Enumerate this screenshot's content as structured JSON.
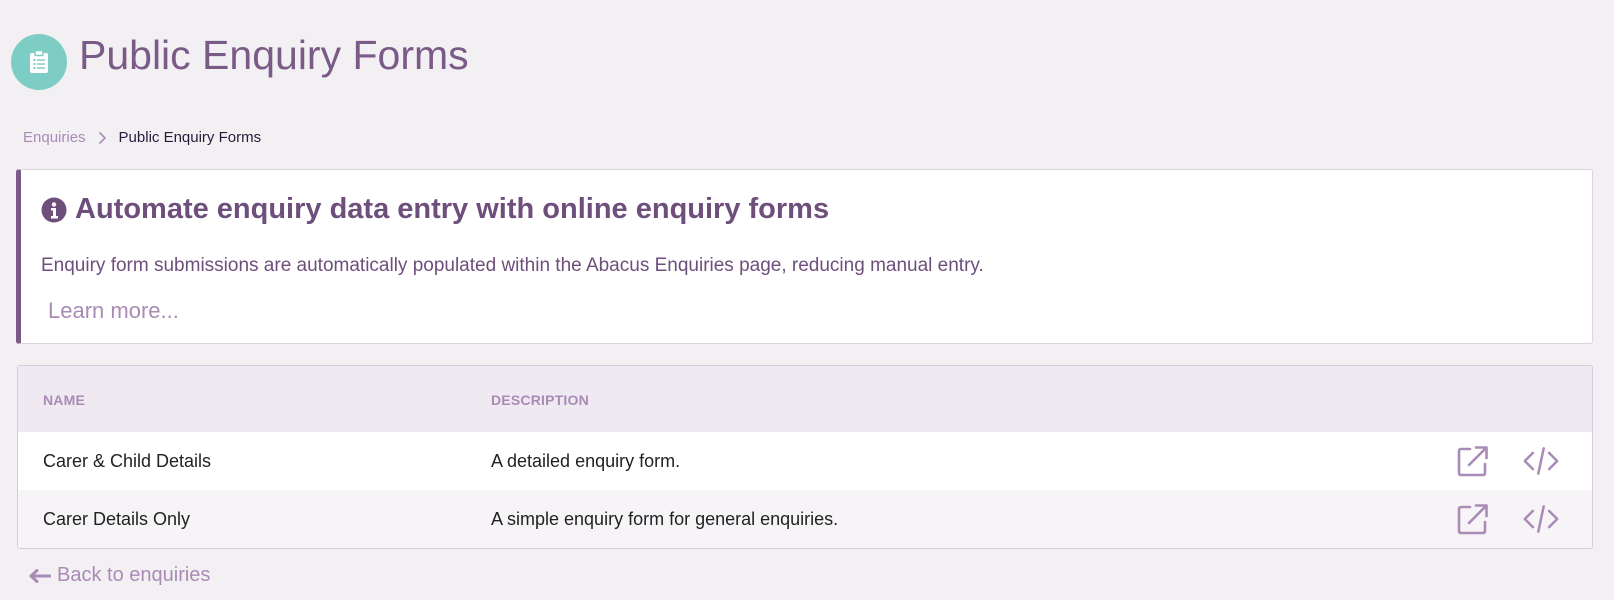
{
  "page": {
    "title": "Public Enquiry Forms",
    "icon": "clipboard-icon",
    "icon_color": "#7ecdc4",
    "accent_color": "#7a5a86"
  },
  "breadcrumb": {
    "parent": "Enquiries",
    "current": "Public Enquiry Forms"
  },
  "info": {
    "title": "Automate enquiry data entry with online enquiry forms",
    "description": "Enquiry form submissions are automatically populated within the Abacus Enquiries page, reducing manual entry.",
    "learn_more": "Learn more..."
  },
  "table": {
    "columns": [
      "NAME",
      "DESCRIPTION"
    ],
    "rows": [
      {
        "name": "Carer & Child Details",
        "description": "A detailed enquiry form.",
        "actions": [
          "external-link-icon",
          "code-icon"
        ]
      },
      {
        "name": "Carer Details Only",
        "description": "A simple enquiry form for general enquiries.",
        "actions": [
          "external-link-icon",
          "code-icon"
        ]
      }
    ]
  },
  "footer": {
    "back_label": "Back to enquiries"
  }
}
